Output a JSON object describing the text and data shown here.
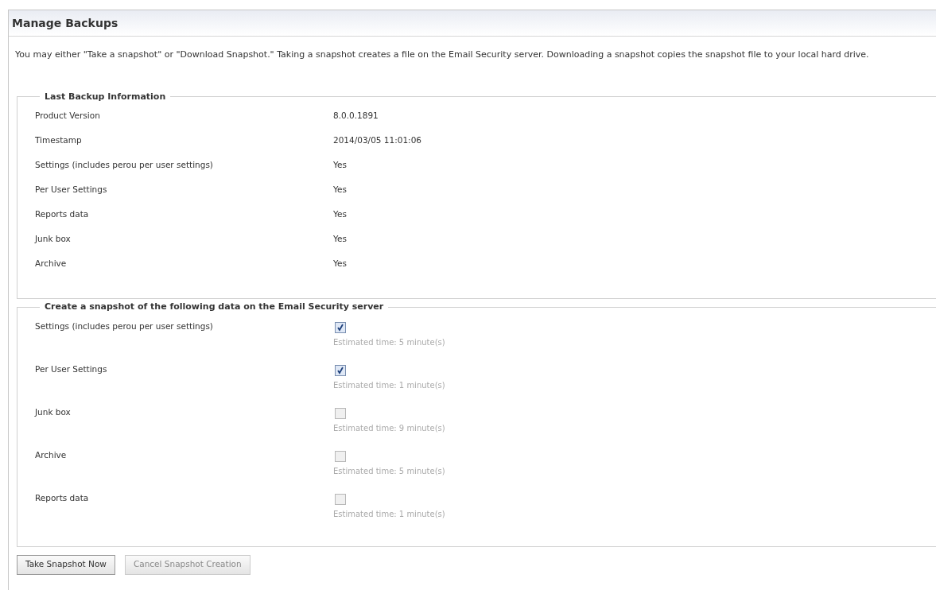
{
  "panel": {
    "title": "Manage Backups",
    "description": "You may either \"Take a snapshot\" or \"Download Snapshot.\" Taking a snapshot creates a file on the Email Security server. Downloading a snapshot copies the snapshot file to your local hard drive."
  },
  "last_backup": {
    "legend": "Last Backup Information",
    "rows": [
      {
        "label": "Product Version",
        "value": "8.0.0.1891"
      },
      {
        "label": "Timestamp",
        "value": "2014/03/05 11:01:06"
      },
      {
        "label": "Settings (includes perou per user settings)",
        "value": "Yes"
      },
      {
        "label": "Per User Settings",
        "value": "Yes"
      },
      {
        "label": "Reports data",
        "value": "Yes"
      },
      {
        "label": "Junk box",
        "value": "Yes"
      },
      {
        "label": "Archive",
        "value": "Yes"
      }
    ]
  },
  "snapshot": {
    "legend": "Create a snapshot of the following data on the Email Security server",
    "items": [
      {
        "label": "Settings (includes perou per user settings)",
        "checked": true,
        "estimate": "Estimated time: 5 minute(s)"
      },
      {
        "label": "Per User Settings",
        "checked": true,
        "estimate": "Estimated time: 1 minute(s)"
      },
      {
        "label": "Junk box",
        "checked": false,
        "estimate": "Estimated time: 9 minute(s)"
      },
      {
        "label": "Archive",
        "checked": false,
        "estimate": "Estimated time: 5 minute(s)"
      },
      {
        "label": "Reports data",
        "checked": false,
        "estimate": "Estimated time: 1 minute(s)"
      }
    ]
  },
  "buttons": [
    {
      "label": "Take Snapshot Now",
      "disabled": false
    },
    {
      "label": "Cancel Snapshot Creation",
      "disabled": true
    }
  ]
}
